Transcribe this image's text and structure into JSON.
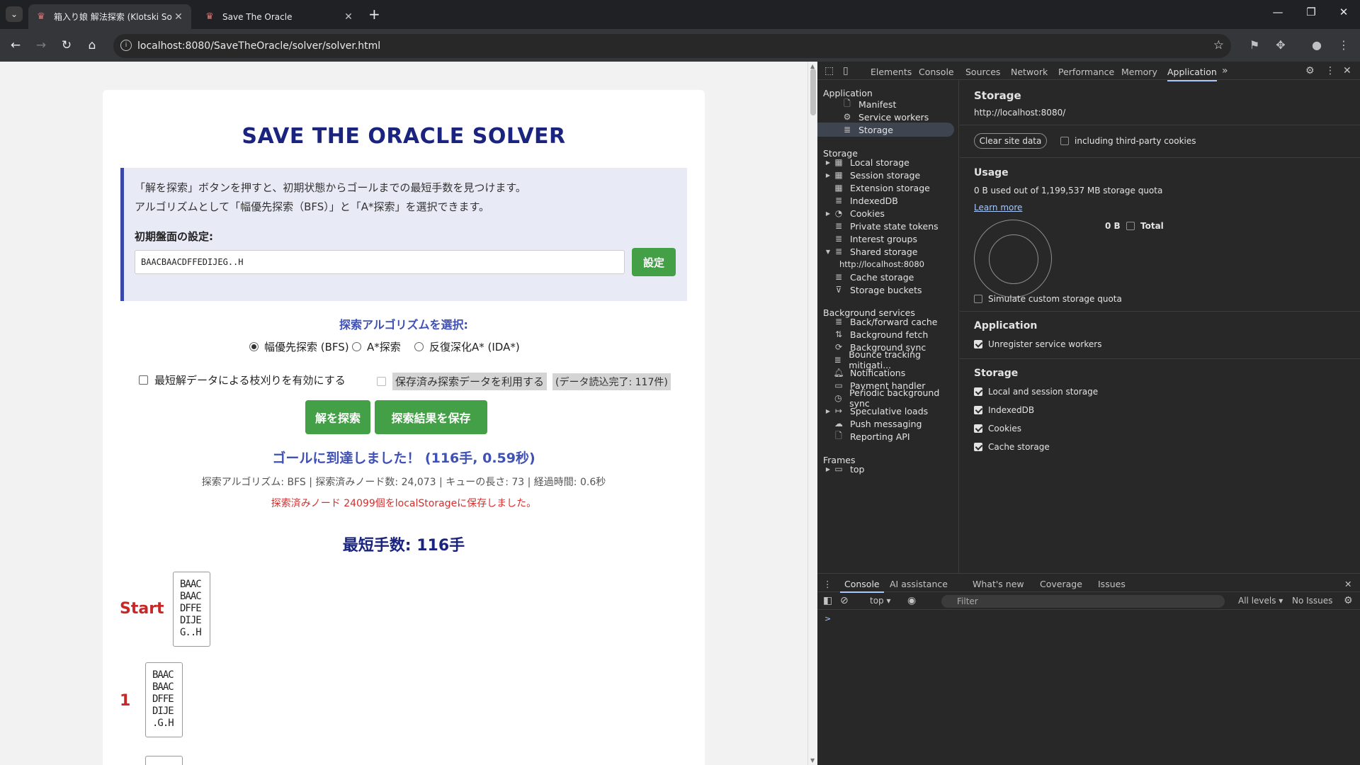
{
  "browser": {
    "tabs": [
      {
        "title": "箱入り娘 解法探索 (Klotski Solver)",
        "favicon": "robot-favicon-icon"
      },
      {
        "title": "Save The Oracle",
        "favicon": "robot-favicon-icon"
      }
    ],
    "url": "localhost:8080/SaveTheOracle/solver/solver.html"
  },
  "page": {
    "title": "SAVE THE ORACLE SOLVER",
    "intro_line1": "「解を探索」ボタンを押すと、初期状態からゴールまでの最短手数を見つけます。",
    "intro_line2": "アルゴリズムとして「幅優先探索（BFS）」と「A*探索」を選択できます。",
    "config_label": "初期盤面の設定:",
    "config_value": "BAACBAACDFFEDIJEG..H",
    "config_button": "設定",
    "algo_title": "探索アルゴリズムを選択:",
    "algorithms": [
      {
        "label": "幅優先探索 (BFS)",
        "selected": true
      },
      {
        "label": "A*探索",
        "selected": false
      },
      {
        "label": "反復深化A* (IDA*)",
        "selected": false
      }
    ],
    "prune_label": "最短解データによる枝刈りを有効にする",
    "use_saved_label": "保存済み探索データを利用する",
    "load_status": "(データ読込完了: 117件)",
    "solve_button": "解を探索",
    "save_button": "探索結果を保存",
    "goal_message": "ゴールに到達しました！ (116手, 0.59秒)",
    "stats": "探索アルゴリズム: BFS | 探索済みノード数: 24,073 | キューの長さ: 73 | 経過時間: 0.6秒",
    "saved_message": "探索済みノード 24099個をlocalStorageに保存しました。",
    "shortest": "最短手数: 116手",
    "steps": [
      {
        "label": "Start",
        "board": "BAAC\nBAAC\nDFFE\nDIJE\nG..H"
      },
      {
        "label": "1",
        "board": "BAAC\nBAAC\nDFFE\nDIJE\n.G.H"
      }
    ]
  },
  "devtools": {
    "tabs": [
      "Elements",
      "Console",
      "Sources",
      "Network",
      "Performance",
      "Memory",
      "Application"
    ],
    "active_tab": "Application",
    "sidebar": {
      "application_header": "Application",
      "application_items": [
        "Manifest",
        "Service workers",
        "Storage"
      ],
      "storage_header": "Storage",
      "storage_items": [
        "Local storage",
        "Session storage",
        "Extension storage",
        "IndexedDB",
        "Cookies",
        "Private state tokens",
        "Interest groups",
        "Shared storage",
        "http://localhost:8080",
        "Cache storage",
        "Storage buckets"
      ],
      "bg_header": "Background services",
      "bg_items": [
        "Back/forward cache",
        "Background fetch",
        "Background sync",
        "Bounce tracking mitigati...",
        "Notifications",
        "Payment handler",
        "Periodic background sync",
        "Speculative loads",
        "Push messaging",
        "Reporting API"
      ],
      "frames_header": "Frames",
      "frames_items": [
        "top"
      ]
    },
    "main": {
      "title": "Storage",
      "origin": "http://localhost:8080/",
      "clear_button": "Clear site data",
      "third_party_label": "including third-party cookies",
      "usage_header": "Usage",
      "usage_text": "0 B used out of 1,199,537 MB storage quota",
      "learn_more": "Learn more",
      "total_value": "0 B",
      "total_label": "Total",
      "simulate_label": "Simulate custom storage quota",
      "application_header": "Application",
      "unregister_label": "Unregister service workers",
      "storage_header": "Storage",
      "storage_checks": [
        "Local and session storage",
        "IndexedDB",
        "Cookies",
        "Cache storage"
      ]
    },
    "drawer": {
      "tabs": [
        "Console",
        "AI assistance",
        "What's new",
        "Coverage",
        "Issues"
      ],
      "context": "top",
      "filter_placeholder": "Filter",
      "levels": "All levels",
      "issues": "No Issues",
      "prompt": ">"
    }
  }
}
